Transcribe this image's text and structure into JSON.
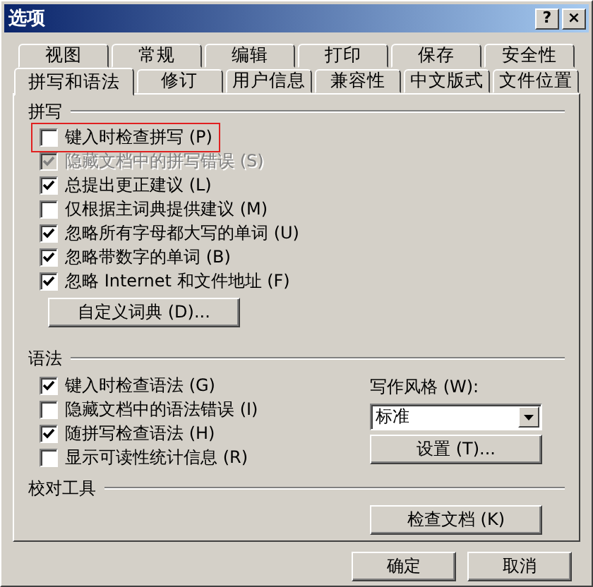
{
  "window": {
    "title": "选项",
    "title_buttons": [
      "?",
      "×"
    ]
  },
  "tabs_back": [
    {
      "label": "视图",
      "selected": false
    },
    {
      "label": "常规",
      "selected": false
    },
    {
      "label": "编辑",
      "selected": false
    },
    {
      "label": "打印",
      "selected": false
    },
    {
      "label": "保存",
      "selected": false
    },
    {
      "label": "安全性",
      "selected": false
    }
  ],
  "tabs_front": [
    {
      "label": "拼写和语法",
      "selected": true
    },
    {
      "label": "修订",
      "selected": false
    },
    {
      "label": "用户信息",
      "selected": false
    },
    {
      "label": "兼容性",
      "selected": false
    },
    {
      "label": "中文版式",
      "selected": false
    },
    {
      "label": "文件位置",
      "selected": false
    }
  ],
  "spelling": {
    "title": "拼写",
    "options": [
      {
        "label": "键入时检查拼写 (P)",
        "checked": false,
        "disabled": false,
        "highlighted": true
      },
      {
        "label": "隐藏文档中的拼写错误 (S)",
        "checked": true,
        "disabled": true,
        "highlighted": false
      },
      {
        "label": "总提出更正建议 (L)",
        "checked": true,
        "disabled": false,
        "highlighted": false
      },
      {
        "label": "仅根据主词典提供建议 (M)",
        "checked": false,
        "disabled": false,
        "highlighted": false
      },
      {
        "label": "忽略所有字母都大写的单词 (U)",
        "checked": true,
        "disabled": false,
        "highlighted": false
      },
      {
        "label": "忽略带数字的单词 (B)",
        "checked": true,
        "disabled": false,
        "highlighted": false
      },
      {
        "label": "忽略 Internet 和文件地址 (F)",
        "checked": true,
        "disabled": false,
        "highlighted": false
      }
    ],
    "button": "自定义词典 (D)..."
  },
  "grammar": {
    "title": "语法",
    "options": [
      {
        "label": "键入时检查语法 (G)",
        "checked": true,
        "disabled": false,
        "highlighted": false
      },
      {
        "label": "隐藏文档中的语法错误 (I)",
        "checked": false,
        "disabled": false,
        "highlighted": false
      },
      {
        "label": "随拼写检查语法 (H)",
        "checked": true,
        "disabled": false,
        "highlighted": false
      },
      {
        "label": "显示可读性统计信息 (R)",
        "checked": false,
        "disabled": false,
        "highlighted": false
      }
    ],
    "style_label": "写作风格 (W):",
    "style_value": "标准",
    "settings_button": "设置 (T)..."
  },
  "proofing": {
    "title": "校对工具",
    "button": "检查文档 (K)"
  },
  "buttons": [
    "确定",
    "取消"
  ]
}
